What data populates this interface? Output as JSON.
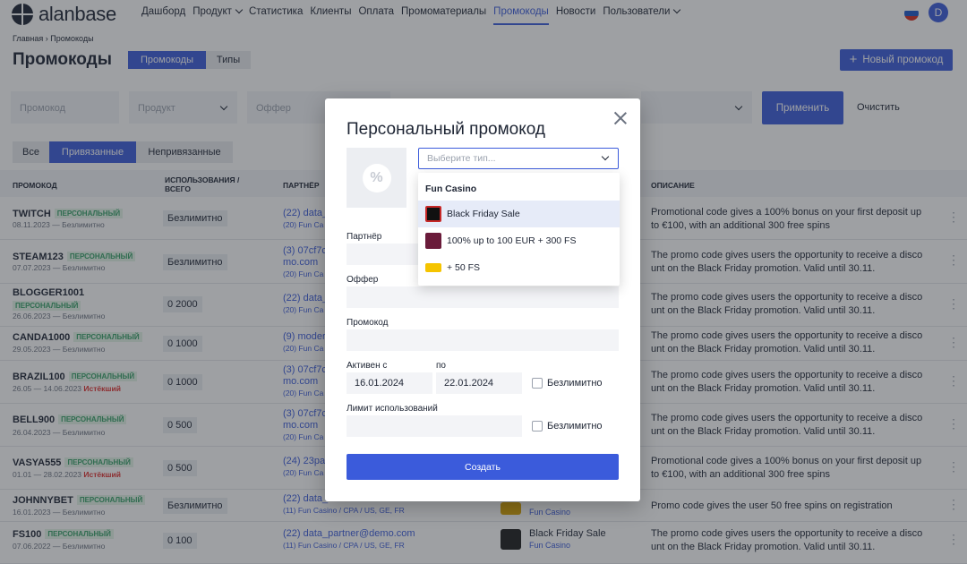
{
  "app": {
    "logo_text": "alanbase",
    "avatar": "D"
  },
  "nav": {
    "items": [
      "Дашборд",
      "Продукт",
      "Статистика",
      "Клиенты",
      "Оплата",
      "Промоматериалы",
      "Промокоды",
      "Новости",
      "Пользователи"
    ],
    "active": "Промокоды"
  },
  "breadcrumb": {
    "home": "Главная",
    "sep": "›",
    "current": "Промокоды"
  },
  "page": {
    "title": "Промокоды",
    "tabs": [
      "Промокоды",
      "Типы"
    ],
    "new_button": "Новый промокод"
  },
  "filters": {
    "promocode_placeholder": "Промокод",
    "product_placeholder": "Продукт",
    "offer_placeholder": "Оффер",
    "apply": "Применить",
    "clear": "Очистить"
  },
  "segments": [
    "Все",
    "Привязанные",
    "Непривязанные"
  ],
  "table": {
    "headers": [
      "ПРОМОКОД",
      "ИСПОЛЬЗОВАНИЯ / ВСЕГО",
      "ПАРТНЁР",
      "ОПИСАНИЕ"
    ],
    "badge": "ПЕРСОНАЛЬНЫЙ",
    "rows": [
      {
        "code": "TWITCH",
        "date": "08.11.2023 — Безлимитно",
        "usage": "Безлимитно",
        "partner": "(22) data_",
        "partner2": "(20) Fun Ca",
        "desc": "Promotional code gives a 100% bonus on your first deposit up to €100, with an additional 300 free spins"
      },
      {
        "code": "STEAM123",
        "date": "07.07.2023 — Безлимитно",
        "usage": "Безлимитно",
        "partner": "(3) 07cf7c",
        "partner2": "mo.com",
        "partner3": "(20) Fun Ca",
        "desc": "The promo code gives users the opportunity to receive a disco unt on the Black Friday promotion. Valid until 30.11."
      },
      {
        "code": "BLOGGER1001",
        "date": "26.06.2023 — Безлимитно",
        "usage": "0  2000",
        "partner": "(22) data_",
        "partner2": "(20) Fun Ca",
        "desc": "The promo code gives users the opportunity to receive a disco unt on the Black Friday promotion. Valid until 30.11."
      },
      {
        "code": "CANDA1000",
        "date": "29.05.2023 — Безлимитно",
        "usage": "0  1000",
        "partner": "(9) moder",
        "partner2": "(20) Fun Ca",
        "desc": "The promo code gives users the opportunity to receive a disco unt on the Black Friday promotion. Valid until 30.11."
      },
      {
        "code": "BRAZIL100",
        "date": "26.05 — 14.06.2023",
        "expiring": "Истёкший",
        "usage": "0  1000",
        "partner": "(3) 07cf7c",
        "partner2": "mo.com",
        "partner3": "(20) Fun Ca",
        "desc": "The promo code gives users the opportunity to receive a disco unt on the Black Friday promotion. Valid until 30.11."
      },
      {
        "code": "BELL900",
        "date": "26.04.2023 — Безлимитно",
        "usage": "0  500",
        "partner": "(3) 07cf7c",
        "partner2": "mo.com",
        "partner3": "(20) Fun Ca",
        "desc": "The promo code gives users the opportunity to receive a disco unt on the Black Friday promotion. Valid until 30.11."
      },
      {
        "code": "VASYA555",
        "date": "01.01 — 28.02.2023",
        "expiring": "Истёкший",
        "usage": "0  500",
        "partner": "(24) 23par",
        "partner2": "(20) Fun Ca",
        "desc": "Promotional code gives a 100% bonus on your first deposit up to €100, with an additional 300 free spins"
      },
      {
        "code": "JOHNNYBET",
        "date": "16.01.2023 — Безлимитно",
        "usage": "Безлимитно",
        "partner": "(22) data_",
        "partner2": "(11) Fun Casino / CPA / US, GE, FR",
        "offer2": "Fun Casino",
        "desc": "Promo code gives the user 50 free spins on registration"
      },
      {
        "code": "FS100",
        "date": "07.06.2022 — Безлимитно",
        "usage": "0  100",
        "partner": "(22) data_partner@demo.com",
        "partner2": "(11) Fun Casino / CPA / US, GE, FR",
        "offer": "Black Friday Sale",
        "offer2": "Fun Casino",
        "desc": "The promo code gives users the opportunity to receive a disco unt on the Black Friday promotion. Valid until 30.11."
      }
    ]
  },
  "modal": {
    "title": "Персональный промокод",
    "type_placeholder": "Выберите тип...",
    "partner_label": "Партнёр",
    "offer_label": "Оффер",
    "promocode_label": "Промокод",
    "active_from_label": "Активен с",
    "active_to_label": "по",
    "date_from": "16.01.2024",
    "date_to": "22.01.2024",
    "unlimited": "Безлимитно",
    "limit_label": "Лимит использований",
    "create": "Создать"
  },
  "dropdown": {
    "group": "Fun Casino",
    "options": [
      "Black Friday Sale",
      "100% up to 100 EUR + 300 FS",
      "+ 50 FS"
    ],
    "selected_index": 0
  },
  "colors": {
    "accent": "#3b5bdb",
    "badge_bg": "#e3f5e8",
    "badge_fg": "#38a169",
    "expired": "#e03131"
  }
}
